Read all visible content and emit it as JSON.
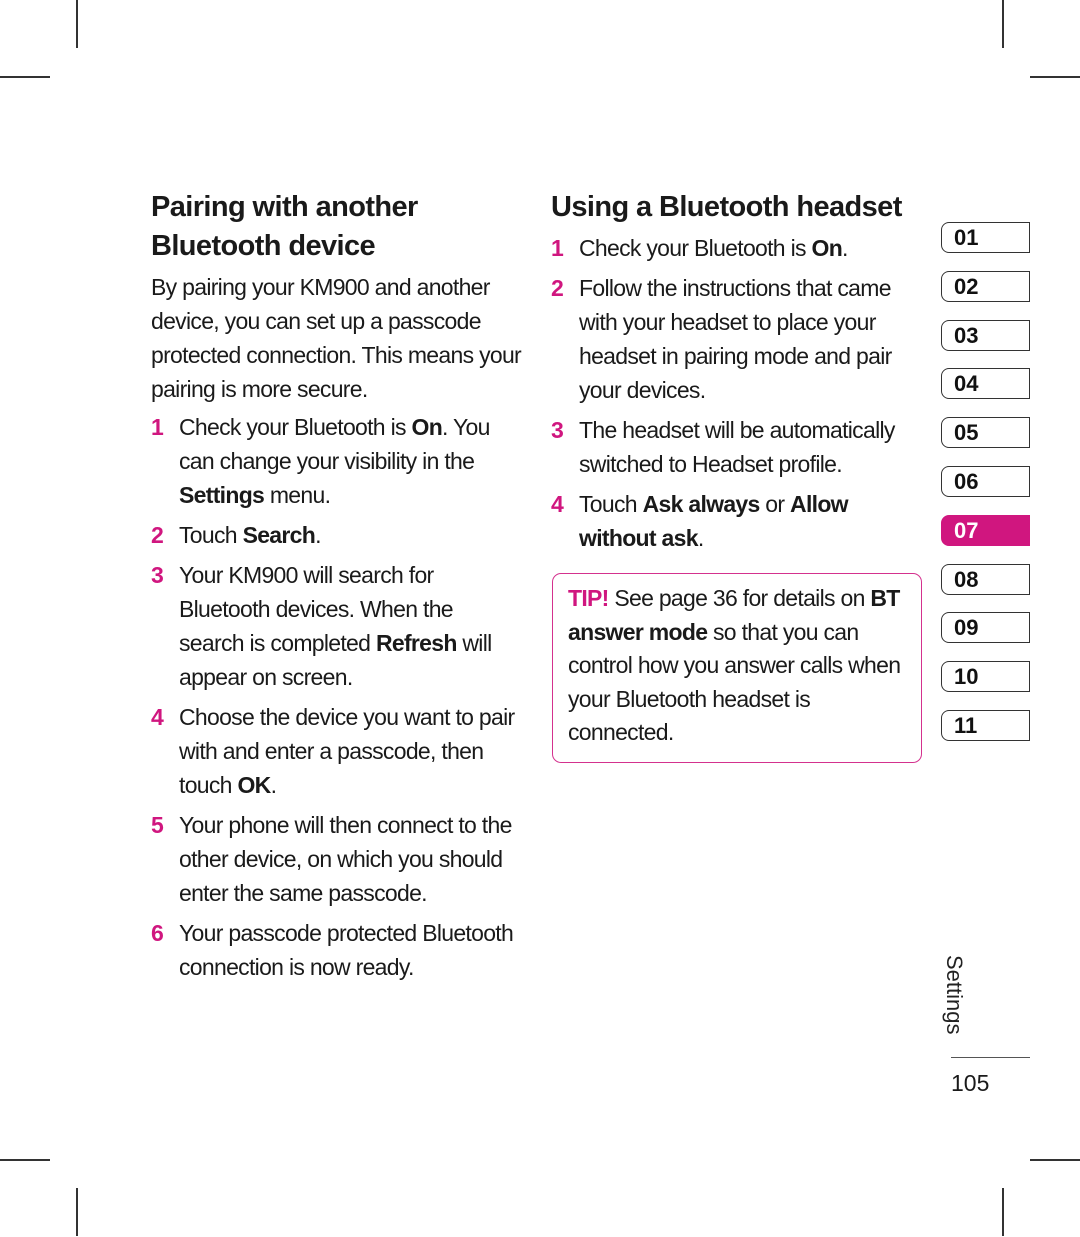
{
  "left_section": {
    "title_line1": "Pairing with another",
    "title_line2": "Bluetooth device",
    "intro": "By pairing your KM900 and another device, you can set up a passcode protected connection. This means your pairing is more secure.",
    "steps": [
      {
        "num": "1",
        "parts": [
          "Check your Bluetooth is ",
          "On",
          ". You can change your visibility in the ",
          "Settings",
          " menu."
        ]
      },
      {
        "num": "2",
        "parts": [
          "Touch ",
          "Search",
          "."
        ]
      },
      {
        "num": "3",
        "parts": [
          "Your KM900 will search for Bluetooth devices. When the search is completed ",
          "Refresh",
          " will appear on screen."
        ]
      },
      {
        "num": "4",
        "parts": [
          "Choose the device you want to pair with and enter a passcode, then touch ",
          "OK",
          "."
        ]
      },
      {
        "num": "5",
        "parts": [
          "Your phone will then connect to the other device, on which you should enter the same passcode."
        ]
      },
      {
        "num": "6",
        "parts": [
          "Your passcode protected Bluetooth connection is now ready."
        ]
      }
    ]
  },
  "right_section": {
    "title": "Using a Bluetooth headset",
    "steps": [
      {
        "num": "1",
        "parts": [
          "Check your Bluetooth is ",
          "On",
          "."
        ]
      },
      {
        "num": "2",
        "parts": [
          "Follow the instructions that came with your headset to place your headset in pairing mode and pair your devices."
        ]
      },
      {
        "num": "3",
        "parts": [
          "The headset will be automatically switched to Headset profile."
        ]
      },
      {
        "num": "4",
        "parts": [
          "Touch ",
          "Ask always",
          " or ",
          "Allow without ask",
          "."
        ]
      }
    ]
  },
  "tip": {
    "label": "TIP!",
    "text1": " See page 36 for details on ",
    "bold": "BT answer mode",
    "text2": " so that you can control how you answer calls when your Bluetooth headset is connected."
  },
  "chapter_tabs": {
    "items": [
      "01",
      "02",
      "03",
      "04",
      "05",
      "06",
      "07",
      "08",
      "09",
      "10",
      "11"
    ],
    "active": "07"
  },
  "footer": {
    "section_label": "Settings",
    "page_number": "105"
  },
  "colors": {
    "accent": "#d0167f",
    "text": "#1a1a1a"
  }
}
